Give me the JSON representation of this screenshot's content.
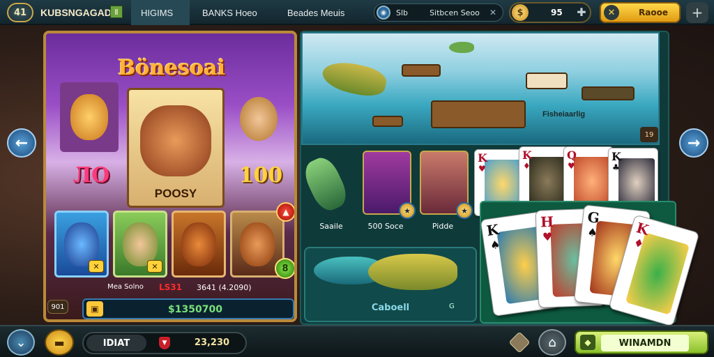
{
  "topbar": {
    "logo_badge": "41",
    "brand": "KUBSNGAGAD",
    "brand_flag": "Ⅱ",
    "tabs": [
      {
        "label": "HIGIMS"
      },
      {
        "label": "BANKS Hoeo"
      },
      {
        "label": "Beades Meuis"
      }
    ],
    "search": {
      "label": "Slb",
      "value": "Sitbcen Seoo"
    },
    "coins": {
      "value": "95"
    },
    "gold_button_label": "Raooe"
  },
  "slot": {
    "title": "Bönesoai",
    "center_label": "POOSY",
    "left_number": "ЛО",
    "right_number": "100",
    "footer_label": "Mea Solno",
    "footer_highlight": "LS31",
    "footer_value": "3641 (4.2090)",
    "win_amount": "$1350700",
    "small_chip": "901",
    "green_chip": "8"
  },
  "right": {
    "scene_label": "Fisheiaarlig",
    "scene_badge": "19",
    "labels": [
      "Saaile",
      "500 Soce",
      "Pidde"
    ],
    "tray_label": "Caboell",
    "tray_small": "G"
  },
  "cards_top": [
    {
      "rank": "K",
      "suit": "♥"
    },
    {
      "rank": "K",
      "suit": "♦"
    },
    {
      "rank": "Q",
      "suit": "♥"
    },
    {
      "rank": "K",
      "suit": "♣"
    }
  ],
  "cards_hand": [
    {
      "rank": "K",
      "suit": "♠"
    },
    {
      "rank": "H",
      "suit": "♥"
    },
    {
      "rank": "G",
      "suit": "♠"
    },
    {
      "rank": "K",
      "suit": "♦"
    }
  ],
  "bottombar": {
    "pill_left": "IDIAT",
    "pill_right": "23,230",
    "cta_label": "WINAMDN"
  }
}
